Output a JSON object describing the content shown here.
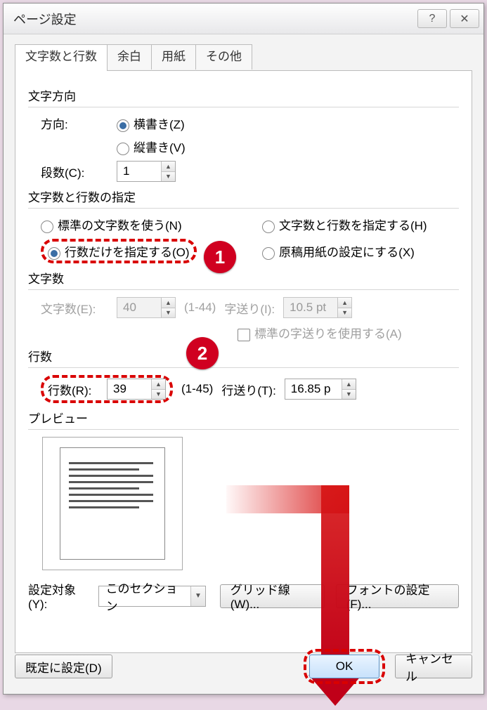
{
  "title": "ページ設定",
  "titlebar": {
    "help": "?",
    "close": "✕"
  },
  "tabs": [
    "文字数と行数",
    "余白",
    "用紙",
    "その他"
  ],
  "grp_direction": {
    "title": "文字方向",
    "label_direction": "方向:",
    "opt_horizontal": "横書き(Z)",
    "opt_vertical": "縦書き(V)",
    "label_columns": "段数(C):",
    "columns": "1"
  },
  "grp_spec": {
    "title": "文字数と行数の指定",
    "opt_std": "標準の文字数を使う(N)",
    "opt_char_line": "文字数と行数を指定する(H)",
    "opt_line_only": "行数だけを指定する(O)",
    "opt_genkou": "原稿用紙の設定にする(X)"
  },
  "grp_chars": {
    "title": "文字数",
    "label_chars": "文字数(E):",
    "chars": "40",
    "chars_range": "(1-44)",
    "label_pitch": "字送り(I):",
    "pitch": "10.5 pt",
    "chk_std_pitch": "標準の字送りを使用する(A)"
  },
  "grp_lines": {
    "title": "行数",
    "label_lines": "行数(R):",
    "lines": "39",
    "lines_range": "(1-45)",
    "label_line_pitch": "行送り(T):",
    "line_pitch": "16.85 p"
  },
  "preview_title": "プレビュー",
  "apply": {
    "label": "設定対象(Y):",
    "value": "このセクション",
    "btn_grid": "グリッド線(W)...",
    "btn_font": "フォントの設定(F)..."
  },
  "buttons": {
    "set_default": "既定に設定(D)",
    "ok": "OK",
    "cancel": "キャンセル"
  },
  "callouts": {
    "c1": "1",
    "c2": "2"
  }
}
